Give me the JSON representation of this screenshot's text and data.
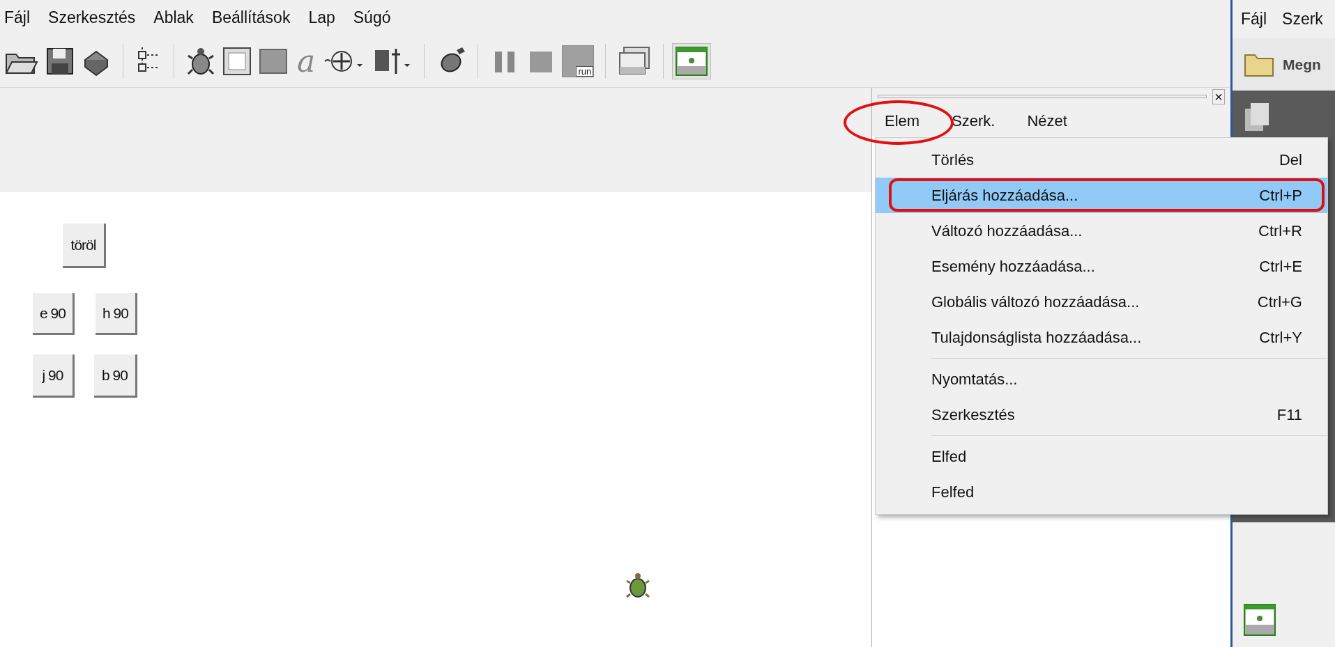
{
  "menu_bar": [
    "Fájl",
    "Szerkesztés",
    "Ablak",
    "Beállítások",
    "Lap",
    "Súgó"
  ],
  "toolbar": {
    "letter_tool": "a",
    "run_label": "run",
    "green_window_selected": true
  },
  "canvas_buttons": [
    {
      "label": "töröl"
    },
    {
      "label": "e 90"
    },
    {
      "label": "h 90"
    },
    {
      "label": "j 90"
    },
    {
      "label": "b 90"
    }
  ],
  "panel": {
    "close": "×",
    "menu": [
      "Elem",
      "Szerk.",
      "Nézet"
    ]
  },
  "dropdown": {
    "groups": [
      [
        {
          "label": "Törlés",
          "shortcut": "Del",
          "selected": false
        },
        {
          "label": "Eljárás hozzáadása...",
          "shortcut": "Ctrl+P",
          "selected": true
        },
        {
          "label": "Változó hozzáadása...",
          "shortcut": "Ctrl+R",
          "selected": false
        },
        {
          "label": "Esemény hozzáadása...",
          "shortcut": "Ctrl+E",
          "selected": false
        },
        {
          "label": "Globális változó hozzáadása...",
          "shortcut": "Ctrl+G",
          "selected": false
        },
        {
          "label": "Tulajdonságlista hozzáadása...",
          "shortcut": "Ctrl+Y",
          "selected": false
        }
      ],
      [
        {
          "label": "Nyomtatás...",
          "selected": false
        },
        {
          "label": "Szerkesztés",
          "shortcut": "F11",
          "selected": false
        }
      ],
      [
        {
          "label": "Elfed",
          "selected": false
        },
        {
          "label": "Felfed",
          "selected": false
        }
      ]
    ]
  },
  "right_window": {
    "menu": [
      "Fájl",
      "Szerk"
    ],
    "open_button": "Megn"
  }
}
